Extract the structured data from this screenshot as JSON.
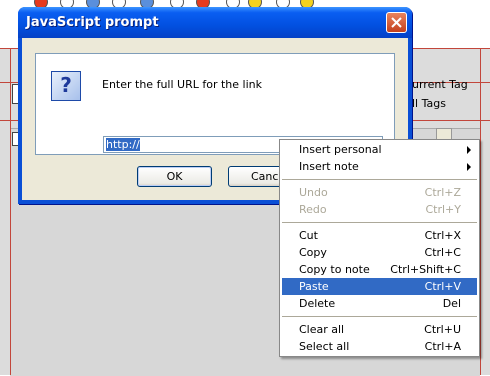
{
  "dialog": {
    "title": "JavaScript prompt",
    "message": "Enter the full URL for the link",
    "input_value": "http://",
    "ok_label": "OK",
    "cancel_label": "Cancel"
  },
  "background": {
    "current_tag_label": "urrent Tag",
    "all_tags_label": "ll Tags"
  },
  "context_menu": {
    "items": [
      {
        "label": "Insert personal",
        "shortcut": "",
        "submenu": true,
        "disabled": false
      },
      {
        "label": "Insert note",
        "shortcut": "",
        "submenu": true,
        "disabled": false
      },
      {
        "label": "Undo",
        "shortcut": "Ctrl+Z",
        "submenu": false,
        "disabled": true
      },
      {
        "label": "Redo",
        "shortcut": "Ctrl+Y",
        "submenu": false,
        "disabled": true
      },
      {
        "label": "Cut",
        "shortcut": "Ctrl+X",
        "submenu": false,
        "disabled": false
      },
      {
        "label": "Copy",
        "shortcut": "Ctrl+C",
        "submenu": false,
        "disabled": false
      },
      {
        "label": "Copy to note",
        "shortcut": "Ctrl+Shift+C",
        "submenu": false,
        "disabled": false
      },
      {
        "label": "Paste",
        "shortcut": "Ctrl+V",
        "submenu": false,
        "disabled": false,
        "highlighted": true
      },
      {
        "label": "Delete",
        "shortcut": "Del",
        "submenu": false,
        "disabled": false
      },
      {
        "label": "Clear all",
        "shortcut": "Ctrl+U",
        "submenu": false,
        "disabled": false
      },
      {
        "label": "Select all",
        "shortcut": "Ctrl+A",
        "submenu": false,
        "disabled": false
      }
    ]
  },
  "colors": {
    "titlebar": "#0250e0",
    "menu_highlight": "#316ac5",
    "dialog_face": "#ece9d8"
  }
}
